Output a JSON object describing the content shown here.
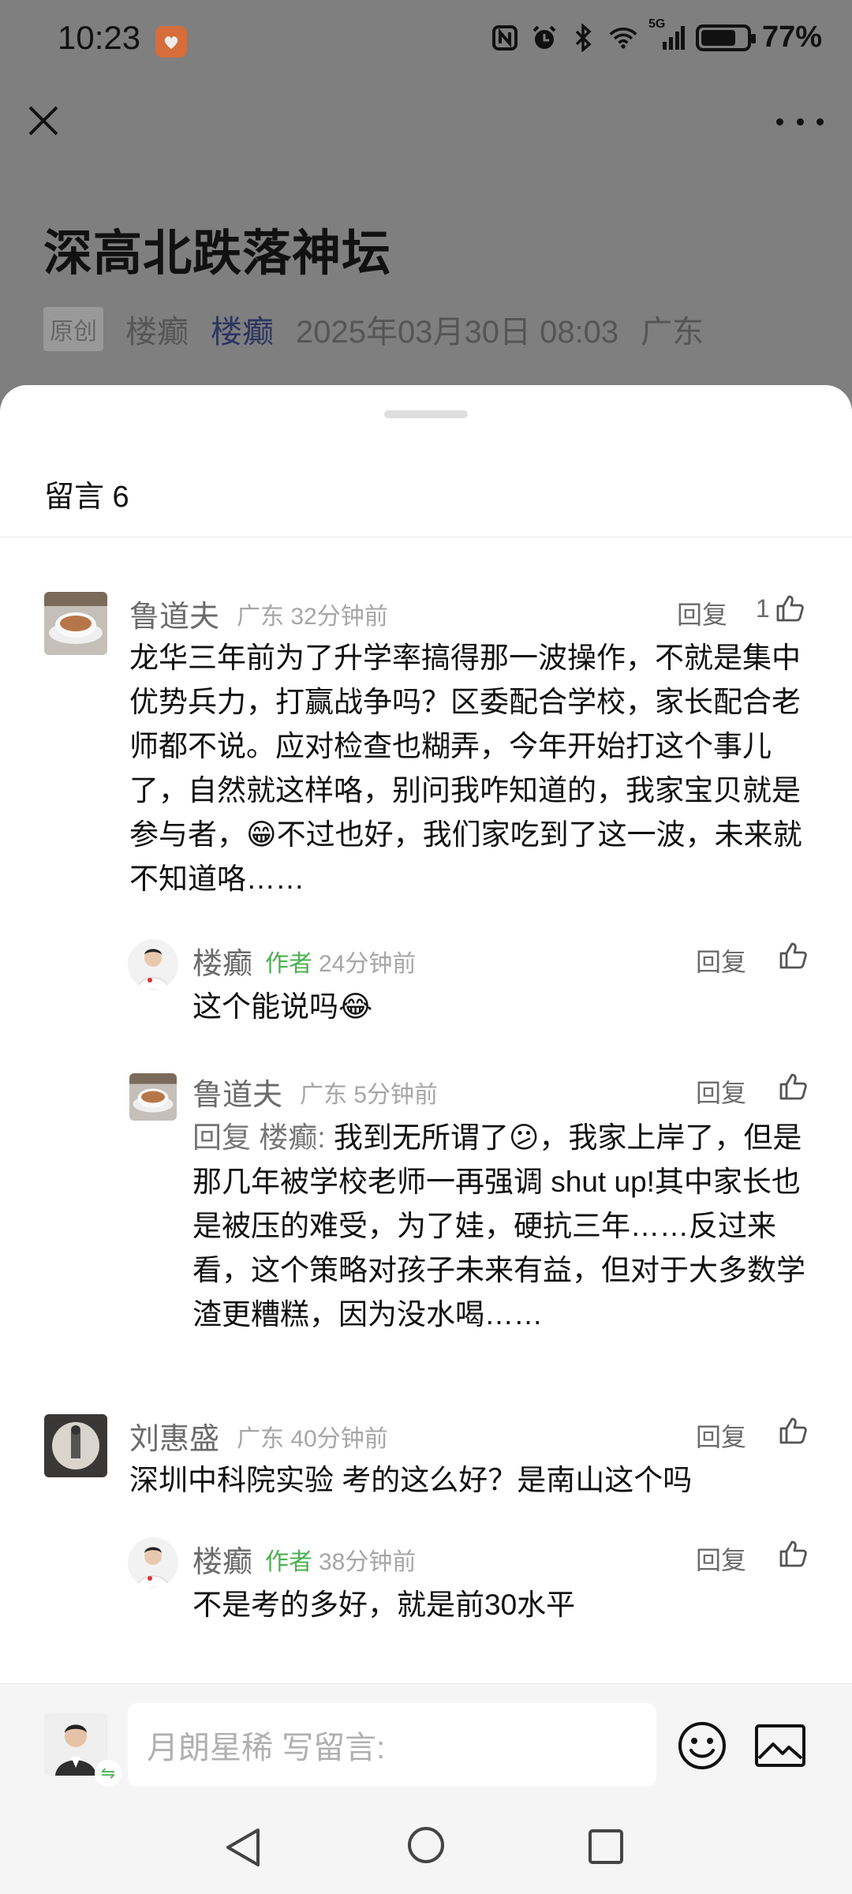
{
  "status": {
    "time": "10:23",
    "network": "5G",
    "battery_percent": "77%",
    "battery_level": 0.77
  },
  "article": {
    "title": "深高北跌落神坛",
    "tag": "原创",
    "author": "楼癫",
    "author_link": "楼癫",
    "datetime": "2025年03月30日 08:03",
    "region": "广东"
  },
  "sheet": {
    "header": "留言 6"
  },
  "comments": [
    {
      "name": "鲁道夫",
      "meta": "广东 32分钟前",
      "reply_label": "回复",
      "likes": "1",
      "text": "龙华三年前为了升学率搞得那一波操作，不就是集中优势兵力，打赢战争吗？区委配合学校，家长配合老师都不说。应对检查也糊弄，今年开始打这个事儿了，自然就这样咯，别问我咋知道的，我家宝贝就是参与者，😁不过也好，我们家吃到了这一波，未来就不知道咯……"
    },
    {
      "name": "楼癫",
      "author_tag": "作者",
      "meta": "24分钟前",
      "reply_label": "回复",
      "text": "这个能说吗😂"
    },
    {
      "name": "鲁道夫",
      "meta": "广东 5分钟前",
      "reply_label": "回复",
      "reply_to": "回复 楼癫:",
      "text": " 我到无所谓了😕，我家上岸了，但是那几年被学校老师一再强调 shut up!其中家长也是被压的难受，为了娃，硬抗三年……反过来看，这个策略对孩子未来有益，但对于大多数学渣更糟糕，因为没水喝……"
    },
    {
      "name": "刘惠盛",
      "meta": "广东 40分钟前",
      "reply_label": "回复",
      "text": "深圳中科院实验 考的这么好？是南山这个吗"
    },
    {
      "name": "楼癫",
      "author_tag": "作者",
      "meta": "38分钟前",
      "reply_label": "回复",
      "text": "不是考的多好，就是前30水平"
    }
  ],
  "input": {
    "placeholder": "月朗星稀 写留言:"
  },
  "icons": {
    "close": "close-icon",
    "more": "more-icon",
    "like": "thumbs-up-icon",
    "emoji": "smiley-icon",
    "image": "image-icon"
  }
}
